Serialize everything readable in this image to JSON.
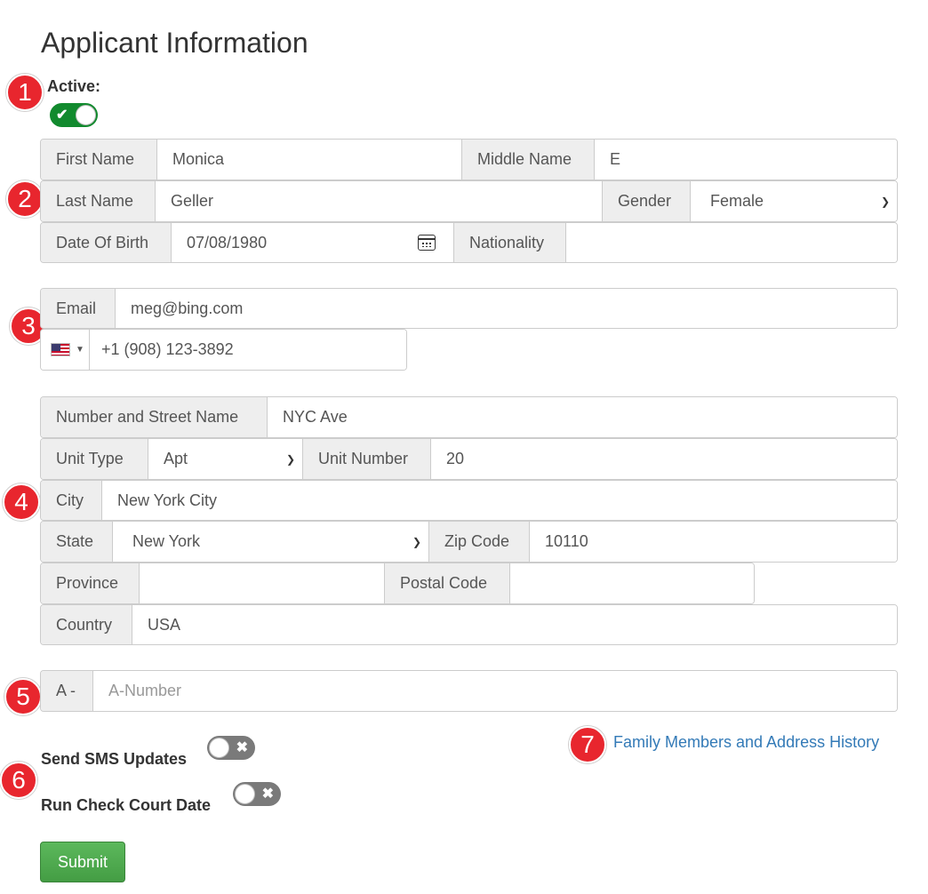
{
  "page": {
    "title": "Applicant Information"
  },
  "active": {
    "label": "Active:",
    "on": true
  },
  "badges": [
    "1",
    "2",
    "3",
    "4",
    "5",
    "6",
    "7"
  ],
  "personal": {
    "first_name": {
      "label": "First Name",
      "value": "Monica"
    },
    "middle_name": {
      "label": "Middle Name",
      "value": "E"
    },
    "last_name": {
      "label": "Last Name",
      "value": "Geller"
    },
    "gender": {
      "label": "Gender",
      "value": "Female"
    },
    "dob": {
      "label": "Date Of Birth",
      "value": "07/08/1980"
    },
    "nationality": {
      "label": "Nationality",
      "value": ""
    }
  },
  "contact": {
    "email": {
      "label": "Email",
      "value": "meg@bing.com"
    },
    "phone": {
      "value": "+1 (908) 123-3892",
      "country_icon": "us-flag-icon"
    }
  },
  "address": {
    "street": {
      "label": "Number and Street Name",
      "value": "NYC Ave"
    },
    "unit_type": {
      "label": "Unit Type",
      "value": "Apt"
    },
    "unit_number": {
      "label": "Unit Number",
      "value": "20"
    },
    "city": {
      "label": "City",
      "value": "New York City"
    },
    "state": {
      "label": "State",
      "value": "New York"
    },
    "zip": {
      "label": "Zip Code",
      "value": "10110"
    },
    "province": {
      "label": "Province",
      "value": ""
    },
    "postal_code": {
      "label": "Postal Code",
      "value": ""
    },
    "country": {
      "label": "Country",
      "value": "USA"
    }
  },
  "a_number": {
    "label": "A -",
    "placeholder": "A-Number",
    "value": ""
  },
  "sms_updates": {
    "label": "Send SMS Updates",
    "on": false
  },
  "court_date": {
    "label": "Run Check Court Date",
    "on": false
  },
  "family_link": {
    "label": "Family Members and Address History"
  },
  "submit": {
    "label": "Submit"
  },
  "colors": {
    "badge": "#e8262e",
    "toggle_on": "#128a2e",
    "toggle_off": "#7a7a7a",
    "link": "#337ab7",
    "submit": "#5cb85c"
  }
}
